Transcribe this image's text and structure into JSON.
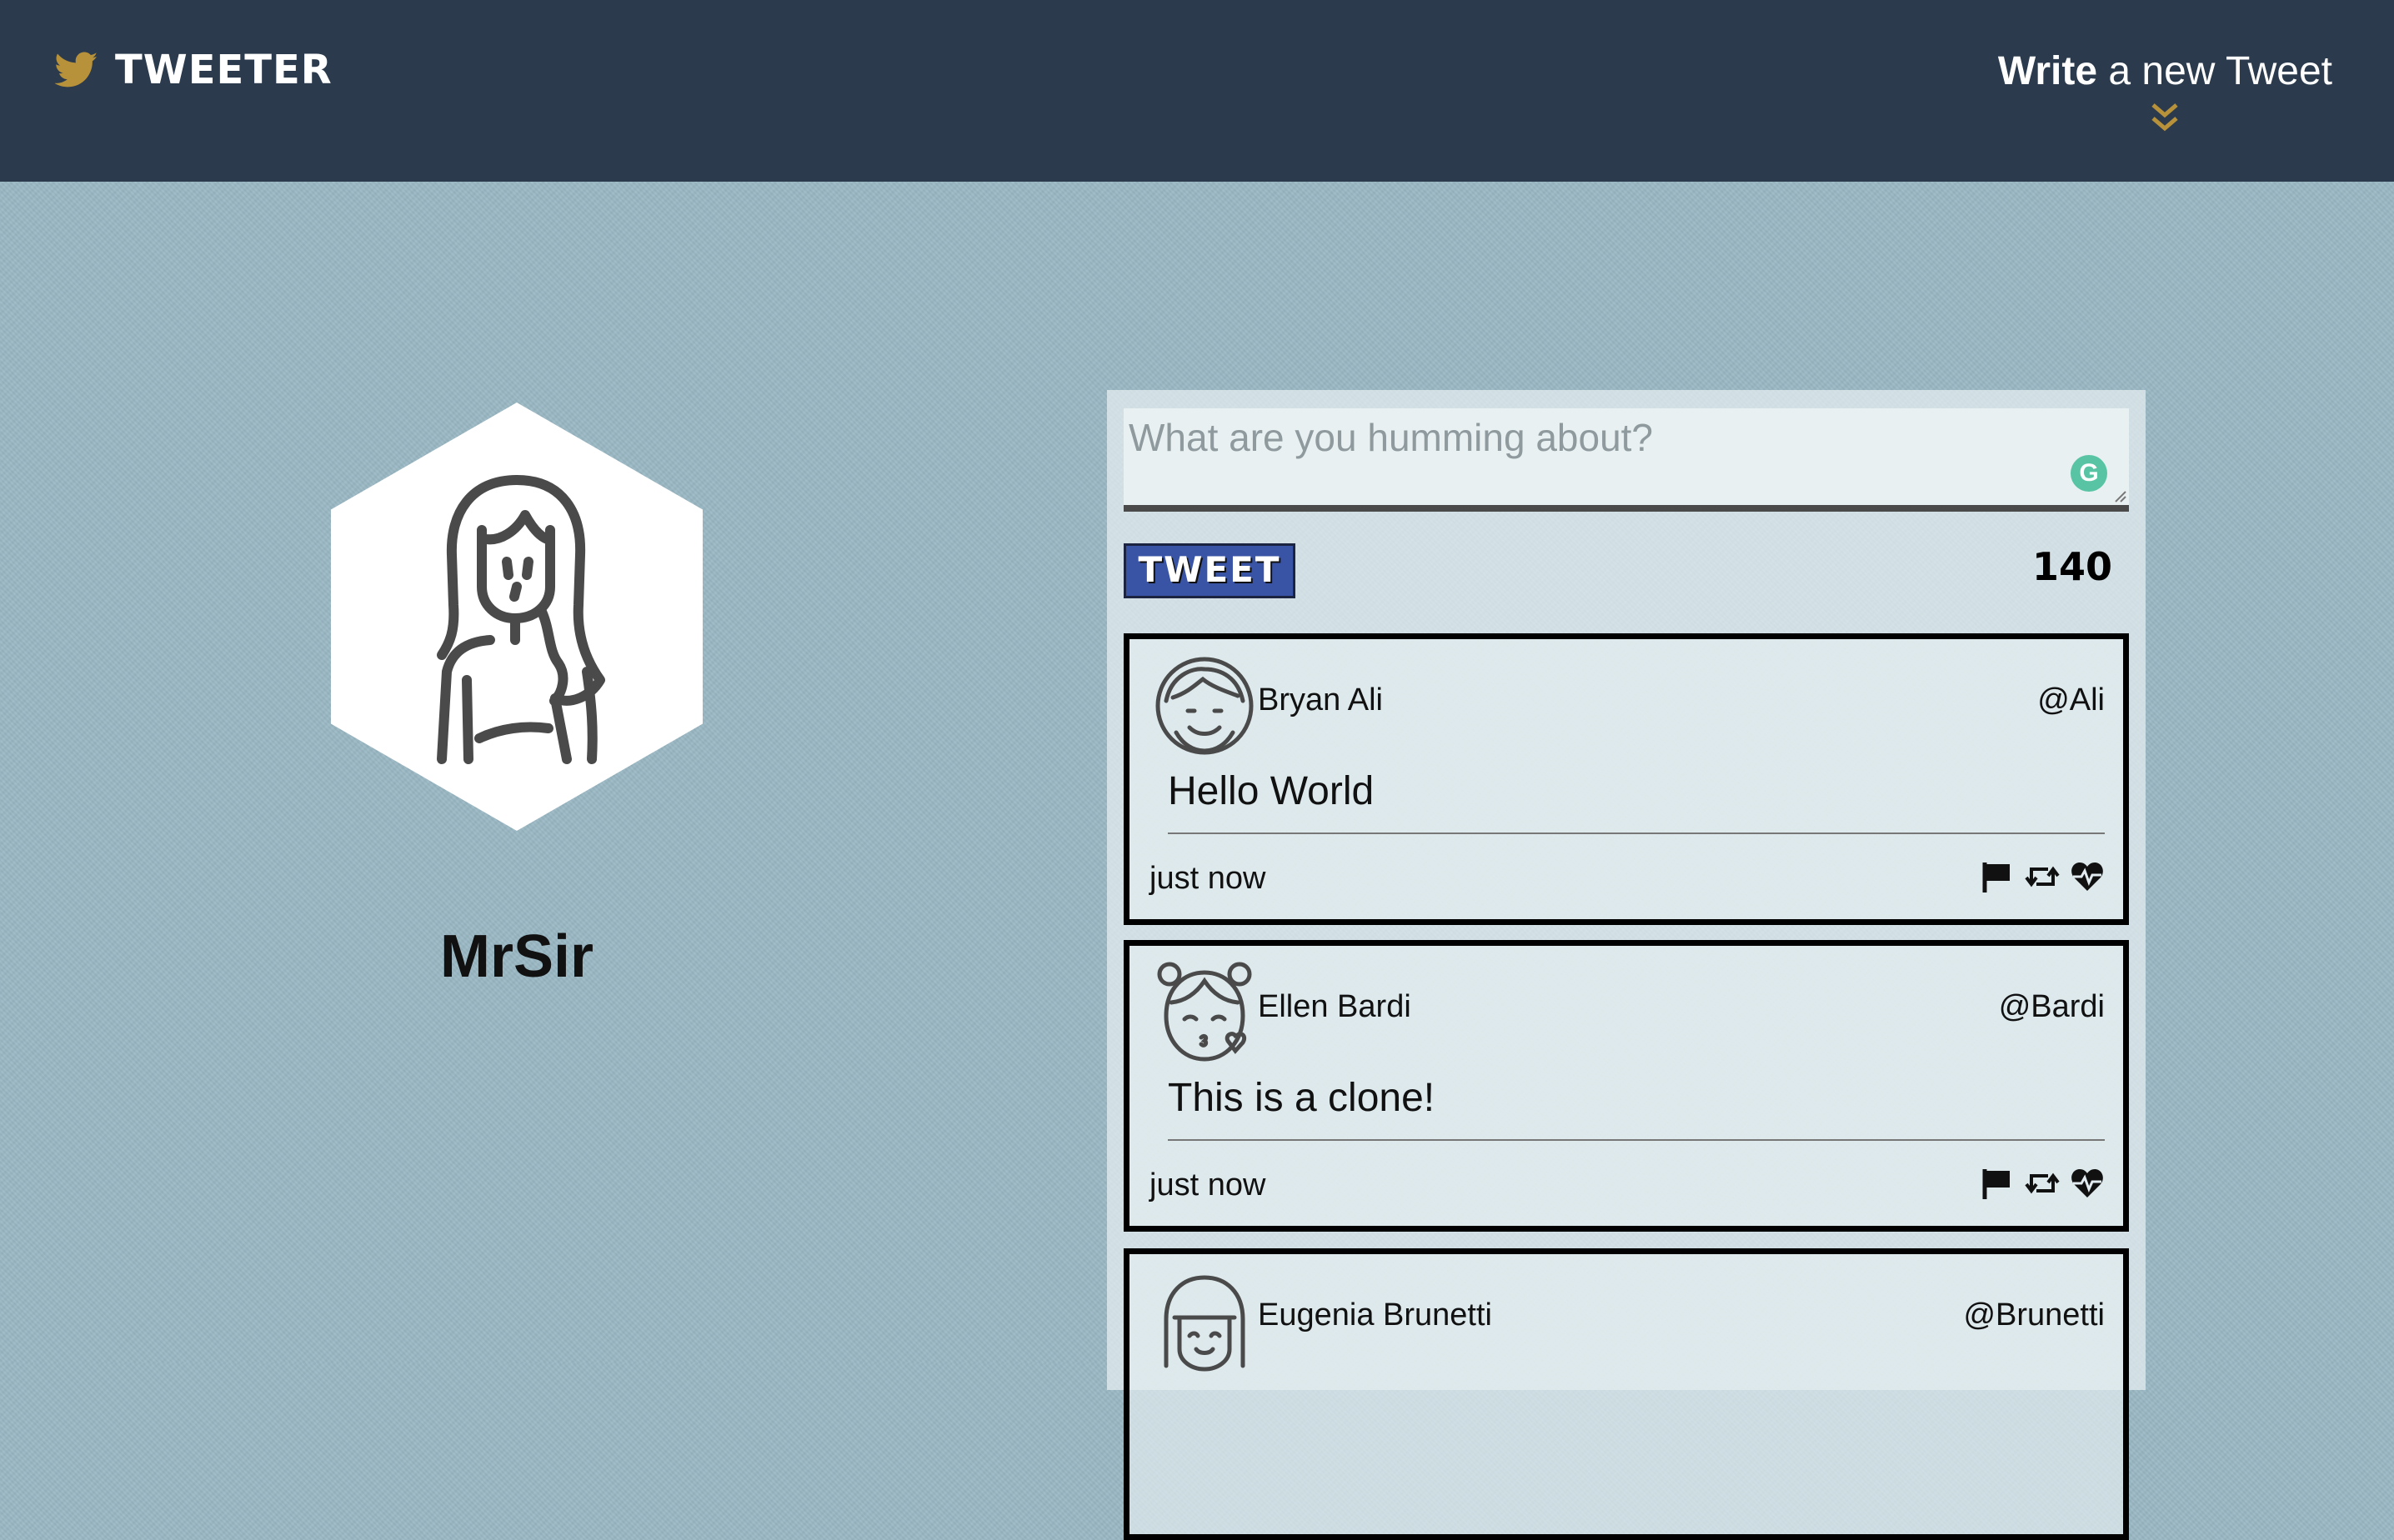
{
  "nav": {
    "brand": "TWEETER",
    "compose_strong": "Write",
    "compose_rest": " a new Tweet",
    "accent_color": "#b8923a",
    "background_color": "#2b3a4c"
  },
  "profile": {
    "name": "MrSir",
    "avatar_icon": "woman-avatar-icon"
  },
  "composer": {
    "placeholder": "What are you humming about?",
    "button_label": "TWEET",
    "char_count": "140",
    "button_color": "#3954a4"
  },
  "tweets": [
    {
      "name": "Bryan Ali",
      "handle": "@Ali",
      "text": "Hello World",
      "time": "just now",
      "avatar_icon": "man-avatar-icon"
    },
    {
      "name": "Ellen Bardi",
      "handle": "@Bardi",
      "text": "This is a clone!",
      "time": "just now",
      "avatar_icon": "girl-kiss-avatar-icon"
    },
    {
      "name": "Eugenia Brunetti",
      "handle": "@Brunetti",
      "text": "",
      "time": "",
      "avatar_icon": "girl-bangs-avatar-icon"
    }
  ]
}
